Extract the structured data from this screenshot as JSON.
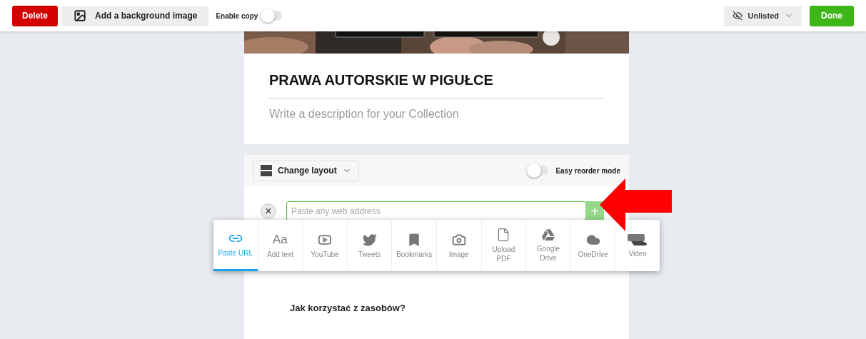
{
  "toolbar": {
    "delete": "Delete",
    "background": "Add a background image",
    "copy_label": "Enable copy",
    "copy_on": false,
    "visibility": "Unlisted",
    "done": "Done"
  },
  "collection": {
    "title": "PRAWA AUTORSKIE W PIGUŁCE",
    "description_placeholder": "Write a description for your Collection"
  },
  "editor": {
    "layout": "Change layout",
    "reorder_label": "Easy reorder mode",
    "reorder_on": false,
    "close": "×",
    "url_placeholder": "Paste any web address",
    "add": "+"
  },
  "sources": [
    {
      "kind": "link",
      "label": "Paste URL",
      "selected": true
    },
    {
      "kind": "text",
      "glyph": "Aa",
      "label": "Add text",
      "selected": false
    },
    {
      "kind": "youtube",
      "label": "YouTube",
      "selected": false
    },
    {
      "kind": "tweet",
      "label": "Tweets",
      "selected": false
    },
    {
      "kind": "bookmark",
      "label": "Bookmarks",
      "selected": false
    },
    {
      "kind": "camera",
      "label": "Image",
      "selected": false
    },
    {
      "kind": "pdf",
      "label": "Upload PDF",
      "selected": false
    },
    {
      "kind": "drive",
      "label": "Google Drive",
      "selected": false
    },
    {
      "kind": "cloud",
      "label": "OneDrive",
      "selected": false
    },
    {
      "kind": "video",
      "label": "Video",
      "selected": false
    }
  ],
  "content": {
    "heading": "Jak korzystać z zasobów?"
  }
}
